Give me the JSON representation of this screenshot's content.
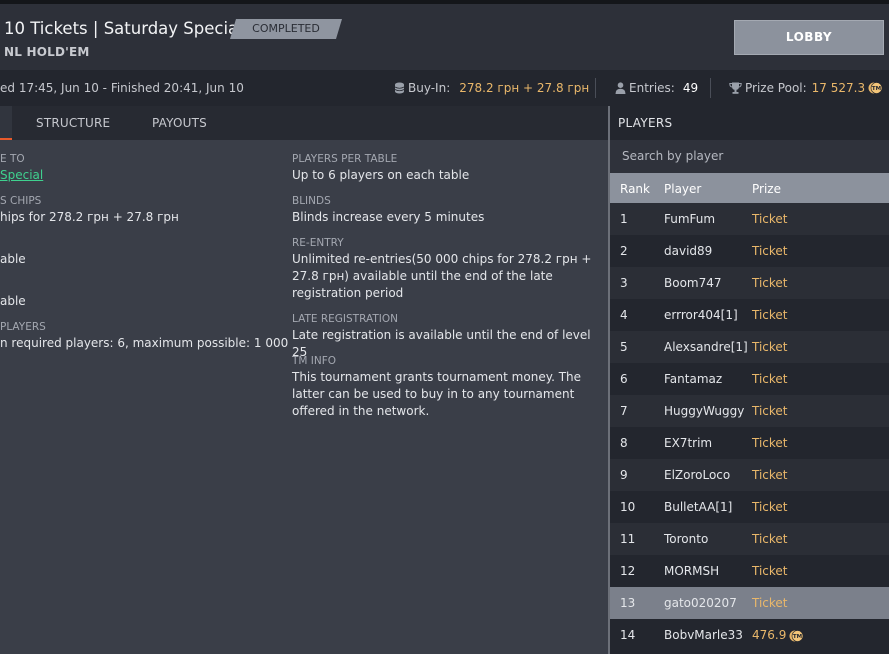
{
  "tournament": {
    "title": "10 Tickets | Saturday Special",
    "game": "NL HOLD'EM",
    "status": "COMPLETED",
    "lobby_label": "LOBBY",
    "dates": "ed 17:45, Jun 10  -  Finished 20:41, Jun 10",
    "buyin_label": "Buy-In:",
    "buyin_value": "278.2 грн + 27.8 грн",
    "entries_label": "Entries:",
    "entries_value": "49",
    "prize_label": "Prize Pool:",
    "prize_value": "17 527.3",
    "colors": {
      "accent": "#e85a2b",
      "gold": "#e9b76a",
      "link": "#3fd18f"
    }
  },
  "tabs": [
    "STRUCTURE",
    "PAYOUTS"
  ],
  "details": {
    "left": [
      {
        "label": "E TO",
        "value": "Special",
        "is_link": true
      },
      {
        "label": "S CHIPS",
        "value": "hips for 278.2 грн + 27.8 грн"
      },
      {
        "label": "",
        "value": "able"
      },
      {
        "label": "",
        "value": "able"
      },
      {
        "label": "PLAYERS",
        "value": "n required players: 6, maximum possible: 1 000"
      }
    ],
    "right": [
      {
        "label": "PLAYERS PER TABLE",
        "value": "Up to 6 players on each table"
      },
      {
        "label": "BLINDS",
        "value": "Blinds increase every 5 minutes"
      },
      {
        "label": "RE-ENTRY",
        "value": "Unlimited re-entries(50 000 chips for 278.2 грн + 27.8 грн) available until the end of the late registration period"
      },
      {
        "label": "LATE REGISTRATION",
        "value": "Late registration is available until the end of level 25"
      },
      {
        "label": "TM INFO",
        "value": "This tournament grants tournament money. The latter can be used to buy in to any tournament offered in the network."
      }
    ]
  },
  "players": {
    "title": "PLAYERS",
    "search_placeholder": "Search by player",
    "columns": [
      "Rank",
      "Player",
      "Prize"
    ],
    "rows": [
      {
        "rank": "1",
        "player": "FumFum",
        "prize": "Ticket"
      },
      {
        "rank": "2",
        "player": "david89",
        "prize": "Ticket"
      },
      {
        "rank": "3",
        "player": "Boom747",
        "prize": "Ticket"
      },
      {
        "rank": "4",
        "player": "errror404[1]",
        "prize": "Ticket"
      },
      {
        "rank": "5",
        "player": "Alexsandre[1]",
        "prize": "Ticket"
      },
      {
        "rank": "6",
        "player": "Fantamaz",
        "prize": "Ticket"
      },
      {
        "rank": "7",
        "player": "HuggyWuggy",
        "prize": "Ticket"
      },
      {
        "rank": "8",
        "player": "EX7trim",
        "prize": "Ticket"
      },
      {
        "rank": "9",
        "player": "ElZoroLoco",
        "prize": "Ticket"
      },
      {
        "rank": "10",
        "player": "BulletAA[1]",
        "prize": "Ticket"
      },
      {
        "rank": "11",
        "player": "Toronto",
        "prize": "Ticket"
      },
      {
        "rank": "12",
        "player": "MORMSH",
        "prize": "Ticket"
      },
      {
        "rank": "13",
        "player": "gato020207",
        "prize": "Ticket",
        "selected": true
      },
      {
        "rank": "14",
        "player": "BobvMarle33",
        "prize": "476.9",
        "coin": true
      }
    ]
  }
}
